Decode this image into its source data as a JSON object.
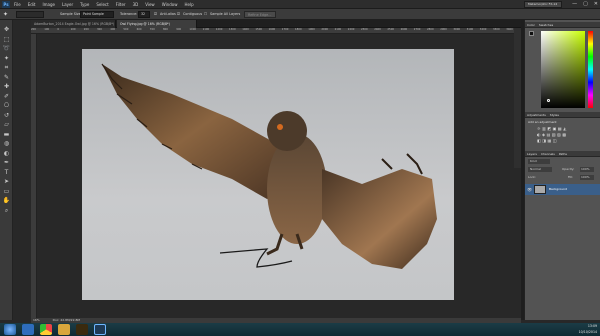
{
  "app": {
    "logo": "Ps",
    "workspace": "Metamorphic FX-14"
  },
  "menu": [
    "File",
    "Edit",
    "Image",
    "Layer",
    "Type",
    "Select",
    "Filter",
    "3D",
    "View",
    "Window",
    "Help"
  ],
  "window_controls": [
    "—",
    "▢",
    "✕"
  ],
  "options_bar": {
    "sample_size_label": "Sample Size:",
    "sample_size_value": "Point Sample",
    "tolerance_label": "Tolerance:",
    "tolerance_value": "32",
    "anti_alias": "Anti-alias",
    "contiguous": "Contiguous",
    "sample_all_layers": "Sample All Layers",
    "refine_edge": "Refine Edge..."
  },
  "tabs": [
    {
      "label": "AdamBurton_2014 Eagle-Owl.jpg @ 16% (RGB/8*)",
      "active": false
    },
    {
      "label": "Owl Flying.jpg @ 16% (RGB/8*)",
      "active": true
    }
  ],
  "ruler_ticks": [
    "200",
    "100",
    "0",
    "100",
    "200",
    "300",
    "400",
    "500",
    "600",
    "700",
    "800",
    "900",
    "1000",
    "1100",
    "1200",
    "1300",
    "1400",
    "1500",
    "1600",
    "1700",
    "1800",
    "1900",
    "2000",
    "2100",
    "2200",
    "2300",
    "2400",
    "2500",
    "2600",
    "2700",
    "2800",
    "2900",
    "3000",
    "3100",
    "3200",
    "3300",
    "3400"
  ],
  "status": {
    "zoom": "16%",
    "doc": "Doc: 22.8M/22.8M"
  },
  "color_panel": {
    "tabs": [
      "Color",
      "Swatches"
    ],
    "fg_color": "#111111",
    "bg_color": "#ffffff"
  },
  "adjustments_panel": {
    "tabs": [
      "Adjustments",
      "Styles"
    ],
    "heading": "Add an adjustment"
  },
  "layers_panel": {
    "tabs": [
      "Layers",
      "Channels",
      "Paths"
    ],
    "kind_label": "Kind",
    "blend_mode": "Normal",
    "opacity_label": "Opacity:",
    "opacity_value": "100%",
    "lock_label": "Lock:",
    "fill_label": "Fill:",
    "fill_value": "100%",
    "layer_name": "Background"
  },
  "taskbar": {
    "time": "13:09",
    "date": "10/10/2014"
  },
  "tools": [
    "move",
    "marquee",
    "lasso",
    "quick-select",
    "crop",
    "eyedropper",
    "healing",
    "brush",
    "stamp",
    "history-brush",
    "eraser",
    "gradient",
    "blur",
    "dodge",
    "pen",
    "type",
    "path-select",
    "shape",
    "hand",
    "zoom"
  ],
  "icons": [
    "photoshop-icon",
    "ie-icon",
    "explorer-icon",
    "chrome-icon",
    "folder-icon",
    "bridge-icon",
    "photoshop-task-icon"
  ]
}
